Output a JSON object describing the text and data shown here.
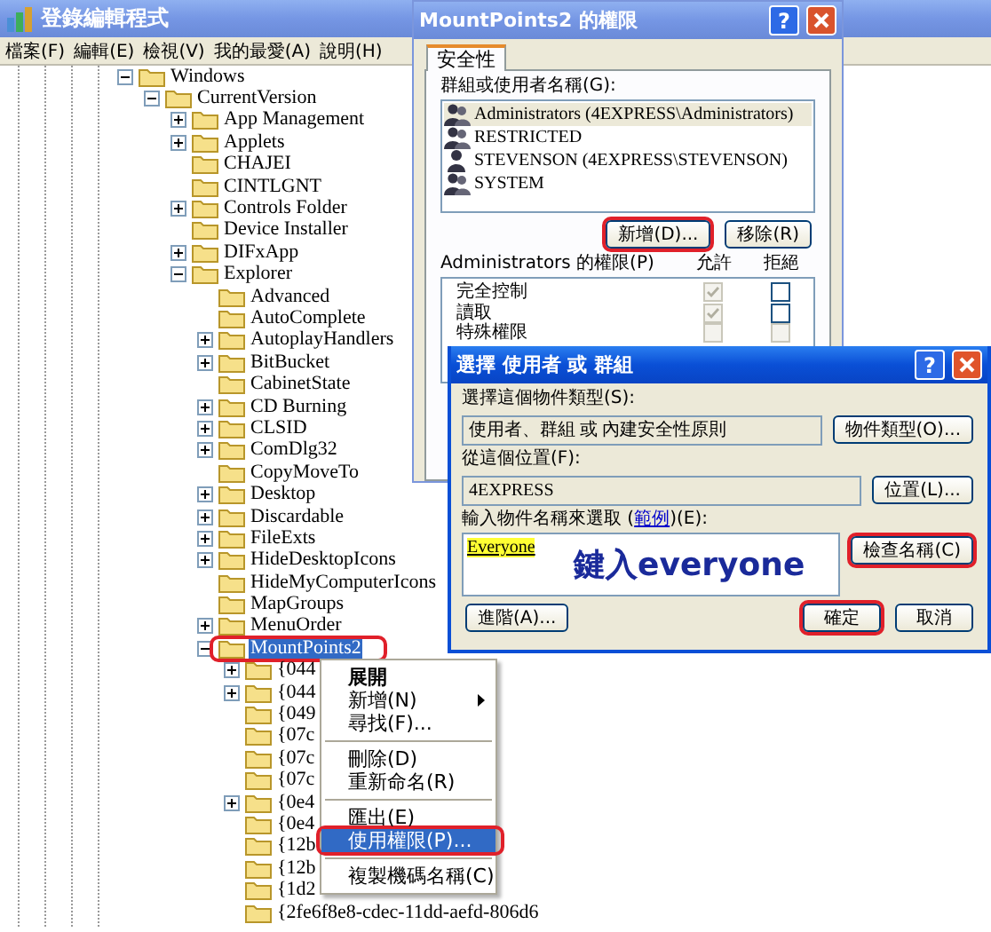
{
  "regedit": {
    "title": "登錄編輯程式",
    "active": false,
    "menu": [
      "檔案(F)",
      "編輯(E)",
      "檢視(V)",
      "我的最愛(A)",
      "說明(H)"
    ],
    "tree": [
      {
        "label": "Windows",
        "expanded": true,
        "selected": false,
        "children": [
          {
            "label": "CurrentVersion",
            "expanded": true,
            "selected": false,
            "children": [
              {
                "label": "App Management",
                "expanded": false,
                "selected": false
              },
              {
                "label": "Applets",
                "expanded": false,
                "selected": false
              },
              {
                "label": "CHAJEI",
                "selected": false
              },
              {
                "label": "CINTLGNT",
                "selected": false
              },
              {
                "label": "Controls Folder",
                "expanded": false,
                "selected": false
              },
              {
                "label": "Device Installer",
                "selected": false
              },
              {
                "label": "DIFxApp",
                "expanded": false,
                "selected": false
              },
              {
                "label": "Explorer",
                "expanded": true,
                "selected": false,
                "children": [
                  {
                    "label": "Advanced",
                    "selected": false
                  },
                  {
                    "label": "AutoComplete",
                    "selected": false
                  },
                  {
                    "label": "AutoplayHandlers",
                    "expanded": false,
                    "selected": false
                  },
                  {
                    "label": "BitBucket",
                    "expanded": false,
                    "selected": false
                  },
                  {
                    "label": "CabinetState",
                    "selected": false
                  },
                  {
                    "label": "CD Burning",
                    "expanded": false,
                    "selected": false
                  },
                  {
                    "label": "CLSID",
                    "expanded": false,
                    "selected": false
                  },
                  {
                    "label": "ComDlg32",
                    "expanded": false,
                    "selected": false
                  },
                  {
                    "label": "CopyMoveTo",
                    "selected": false
                  },
                  {
                    "label": "Desktop",
                    "expanded": false,
                    "selected": false
                  },
                  {
                    "label": "Discardable",
                    "expanded": false,
                    "selected": false
                  },
                  {
                    "label": "FileExts",
                    "expanded": false,
                    "selected": false
                  },
                  {
                    "label": "HideDesktopIcons",
                    "expanded": false,
                    "selected": false
                  },
                  {
                    "label": "HideMyComputerIcons",
                    "selected": false
                  },
                  {
                    "label": "MapGroups",
                    "selected": false
                  },
                  {
                    "label": "MenuOrder",
                    "expanded": false,
                    "selected": false
                  },
                  {
                    "label": "MountPoints2",
                    "expanded": true,
                    "selected": true,
                    "annotated": true,
                    "children": [
                      {
                        "label": "{044",
                        "expanded": false,
                        "selected": false
                      },
                      {
                        "label": "{044",
                        "expanded": false,
                        "selected": false
                      },
                      {
                        "label": "{049",
                        "selected": false
                      },
                      {
                        "label": "{07c",
                        "selected": false
                      },
                      {
                        "label": "{07c",
                        "selected": false
                      },
                      {
                        "label": "{07c",
                        "selected": false
                      },
                      {
                        "label": "{0e4",
                        "expanded": false,
                        "selected": false
                      },
                      {
                        "label": "{0e4",
                        "selected": false
                      },
                      {
                        "label": "{12b",
                        "selected": false
                      },
                      {
                        "label": "{12b",
                        "selected": false
                      },
                      {
                        "label": "{1d2",
                        "selected": false
                      },
                      {
                        "label": "{2fe6f8e8-cdec-11dd-aefd-806d6",
                        "selected": false
                      }
                    ]
                  }
                ]
              }
            ]
          }
        ]
      }
    ]
  },
  "context_menu": [
    {
      "kind": "item",
      "label": "展開",
      "default": true,
      "selected": false
    },
    {
      "kind": "item",
      "label": "新增(N)",
      "submenu": true,
      "selected": false
    },
    {
      "kind": "item",
      "label": "尋找(F)...",
      "selected": false
    },
    {
      "kind": "separator"
    },
    {
      "kind": "item",
      "label": "刪除(D)",
      "selected": false
    },
    {
      "kind": "item",
      "label": "重新命名(R)",
      "selected": false
    },
    {
      "kind": "separator"
    },
    {
      "kind": "item",
      "label": "匯出(E)",
      "selected": false
    },
    {
      "kind": "item",
      "label": "使用權限(P)...",
      "selected": true,
      "annotated": true
    },
    {
      "kind": "separator"
    },
    {
      "kind": "item",
      "label": "複製機碼名稱(C)",
      "selected": false
    }
  ],
  "permissions_dialog": {
    "title": "MountPoints2 的權限",
    "active": false,
    "help": "?",
    "tabs": [
      {
        "label": "安全性",
        "selected": true
      }
    ],
    "users_label": "群組或使用者名稱(G):",
    "users": [
      {
        "kind": "group",
        "name": "Administrators (4EXPRESS\\Administrators)",
        "selected": true
      },
      {
        "kind": "group",
        "name": "RESTRICTED",
        "selected": false
      },
      {
        "kind": "user",
        "name": "STEVENSON (4EXPRESS\\STEVENSON)",
        "selected": false
      },
      {
        "kind": "group",
        "name": "SYSTEM",
        "selected": false
      }
    ],
    "buttons": [
      {
        "label": "新增(D)...",
        "annotated": true
      },
      {
        "label": "移除(R)",
        "annotated": false
      }
    ],
    "perm_label": "Administrators 的權限(P)",
    "allow_label": "允許",
    "deny_label": "拒絕",
    "permissions": [
      {
        "name": "完全控制",
        "allow_checked": true,
        "allow_disabled": true,
        "deny_checked": false,
        "deny_disabled": false
      },
      {
        "name": "讀取",
        "allow_checked": true,
        "allow_disabled": true,
        "deny_checked": false,
        "deny_disabled": false
      },
      {
        "name": "特殊權限",
        "allow_checked": false,
        "allow_disabled": true,
        "deny_checked": false,
        "deny_disabled": true
      }
    ]
  },
  "select_dialog": {
    "title": "選擇 使用者 或 群組",
    "active": true,
    "help": "?",
    "type_label": "選擇這個物件類型(S):",
    "type_value": "使用者、群組 或 內建安全性原則",
    "type_button": "物件類型(O)...",
    "location_label": "從這個位置(F):",
    "location_value": "4EXPRESS",
    "location_button": "位置(L)...",
    "names_label_before": "輸入物件名稱來選取 (",
    "names_link": "範例",
    "names_label_after": ")(E):",
    "names_value": "Everyone",
    "annotation": "鍵入everyone",
    "check_button": {
      "label": "檢查名稱(C)",
      "annotated": true
    },
    "advanced_button": {
      "label": "進階(A)...",
      "annotated": false
    },
    "ok_button": {
      "label": "確定",
      "annotated": true
    },
    "cancel_button": {
      "label": "取消",
      "annotated": false
    }
  }
}
